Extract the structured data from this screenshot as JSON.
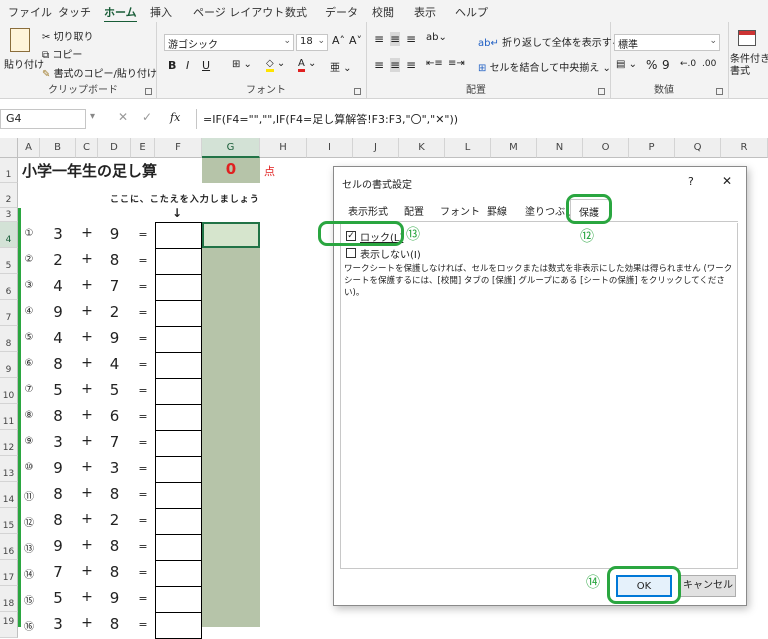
{
  "ribbon_tabs": [
    "ファイル",
    "タッチ",
    "ホーム",
    "挿入",
    "ページ レイアウト",
    "数式",
    "データ",
    "校閲",
    "表示",
    "ヘルプ"
  ],
  "clipboard": {
    "paste": "貼り付け",
    "cut": "切り取り",
    "copy": "コピー",
    "format_painter": "書式のコピー/貼り付け",
    "group": "クリップボード"
  },
  "font": {
    "name": "游ゴシック",
    "size": "18",
    "bold": "B",
    "italic": "I",
    "underline": "U",
    "group": "フォント"
  },
  "alignment": {
    "wrap": "折り返して全体を表示する",
    "merge": "セルを結合して中央揃え",
    "group": "配置"
  },
  "number": {
    "format": "標準",
    "percent": "%",
    "comma": "9",
    "group": "数値"
  },
  "styles": {
    "conditional": "条件付き書式"
  },
  "name_box": "G4",
  "fx": "fx",
  "formula": "=IF(F4=\"\",\"\",IF(F4=足し算解答!F3:F3,\"〇\",\"✕\"))",
  "columns": [
    "A",
    "B",
    "C",
    "D",
    "E",
    "F",
    "G",
    "H",
    "I",
    "J",
    "K",
    "L",
    "M",
    "N",
    "O",
    "P",
    "Q",
    "R"
  ],
  "rows": [
    "1",
    "2",
    "3",
    "4",
    "5",
    "6",
    "7",
    "8",
    "9",
    "10",
    "11",
    "12",
    "13",
    "14",
    "15",
    "16",
    "17",
    "18",
    "19"
  ],
  "sheet": {
    "title": "小学一年生の足し算",
    "score": "0",
    "score_unit": "点",
    "instruction": "ここに、こたえを入力しましょう",
    "arrow": "↓",
    "problems": [
      {
        "n": "①",
        "a": "3",
        "op": "+",
        "b": "9",
        "eq": "="
      },
      {
        "n": "②",
        "a": "2",
        "op": "+",
        "b": "8",
        "eq": "="
      },
      {
        "n": "③",
        "a": "4",
        "op": "+",
        "b": "7",
        "eq": "="
      },
      {
        "n": "④",
        "a": "9",
        "op": "+",
        "b": "2",
        "eq": "="
      },
      {
        "n": "⑤",
        "a": "4",
        "op": "+",
        "b": "9",
        "eq": "="
      },
      {
        "n": "⑥",
        "a": "8",
        "op": "+",
        "b": "4",
        "eq": "="
      },
      {
        "n": "⑦",
        "a": "5",
        "op": "+",
        "b": "5",
        "eq": "="
      },
      {
        "n": "⑧",
        "a": "8",
        "op": "+",
        "b": "6",
        "eq": "="
      },
      {
        "n": "⑨",
        "a": "3",
        "op": "+",
        "b": "7",
        "eq": "="
      },
      {
        "n": "⑩",
        "a": "9",
        "op": "+",
        "b": "3",
        "eq": "="
      },
      {
        "n": "⑪",
        "a": "8",
        "op": "+",
        "b": "8",
        "eq": "="
      },
      {
        "n": "⑫",
        "a": "8",
        "op": "+",
        "b": "2",
        "eq": "="
      },
      {
        "n": "⑬",
        "a": "9",
        "op": "+",
        "b": "8",
        "eq": "="
      },
      {
        "n": "⑭",
        "a": "7",
        "op": "+",
        "b": "8",
        "eq": "="
      },
      {
        "n": "⑮",
        "a": "5",
        "op": "+",
        "b": "9",
        "eq": "="
      },
      {
        "n": "⑯",
        "a": "3",
        "op": "+",
        "b": "8",
        "eq": "="
      }
    ]
  },
  "dialog": {
    "title": "セルの書式設定",
    "help": "?",
    "close": "✕",
    "tabs": [
      "表示形式",
      "配置",
      "フォント",
      "罫線",
      "塗りつぶし",
      "保護"
    ],
    "lock_label": "ロック(L)",
    "hidden_label": "表示しない(I)",
    "description": "ワークシートを保護しなければ、セルをロックまたは数式を非表示にした効果は得られません (ワークシートを保護するには、[校閲] タブの [保護] グループにある [シートの保護] をクリックしてください)。",
    "ok": "OK",
    "cancel": "キャンセル"
  },
  "steps": {
    "protect_tab": "⑫",
    "lock": "⑬",
    "ok": "⑭"
  },
  "colors": {
    "accent": "#217346",
    "highlight": "#2aa640",
    "score": "#e02020",
    "answer_fill": "#b6c4a9"
  }
}
